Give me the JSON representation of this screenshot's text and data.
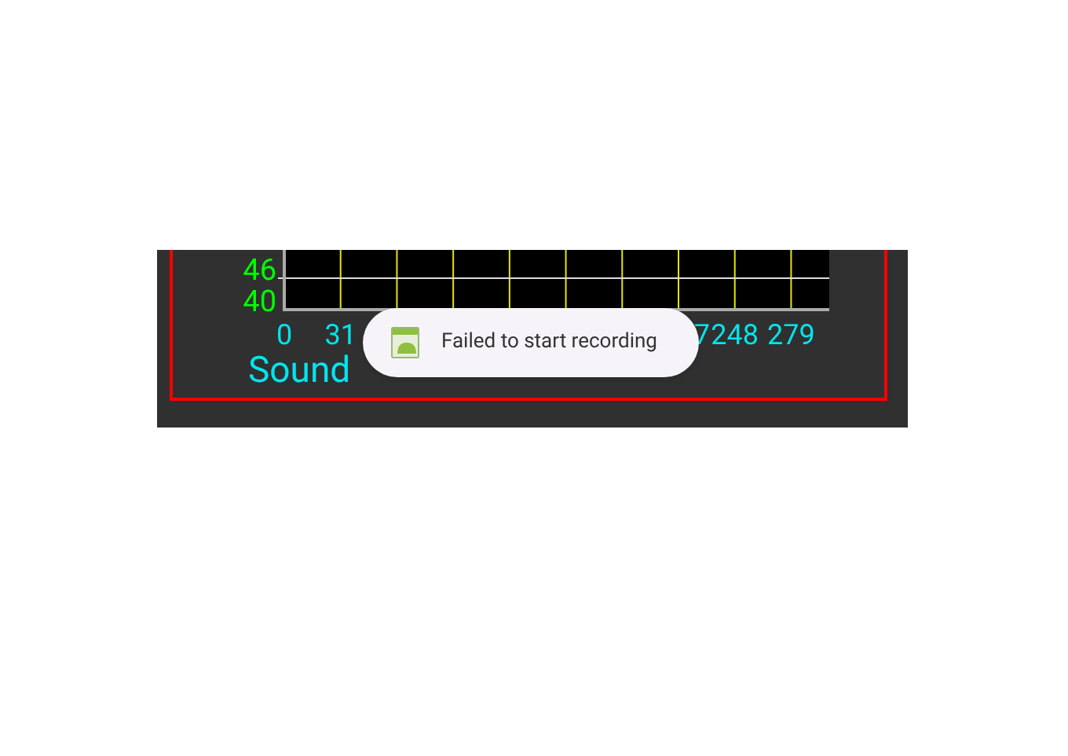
{
  "chart": {
    "chart_data": {
      "type": "line",
      "title": "Sound",
      "xlim": [
        0,
        300
      ],
      "ylim": [
        40,
        51.4
      ],
      "xticks": [
        0,
        31,
        248,
        279
      ],
      "yticks": [
        40,
        46
      ],
      "grid": true,
      "ref_lines": [
        {
          "axis": "y",
          "value": 46
        }
      ]
    },
    "label_fragment": "7"
  },
  "toast": {
    "message": "Failed to start recording"
  }
}
